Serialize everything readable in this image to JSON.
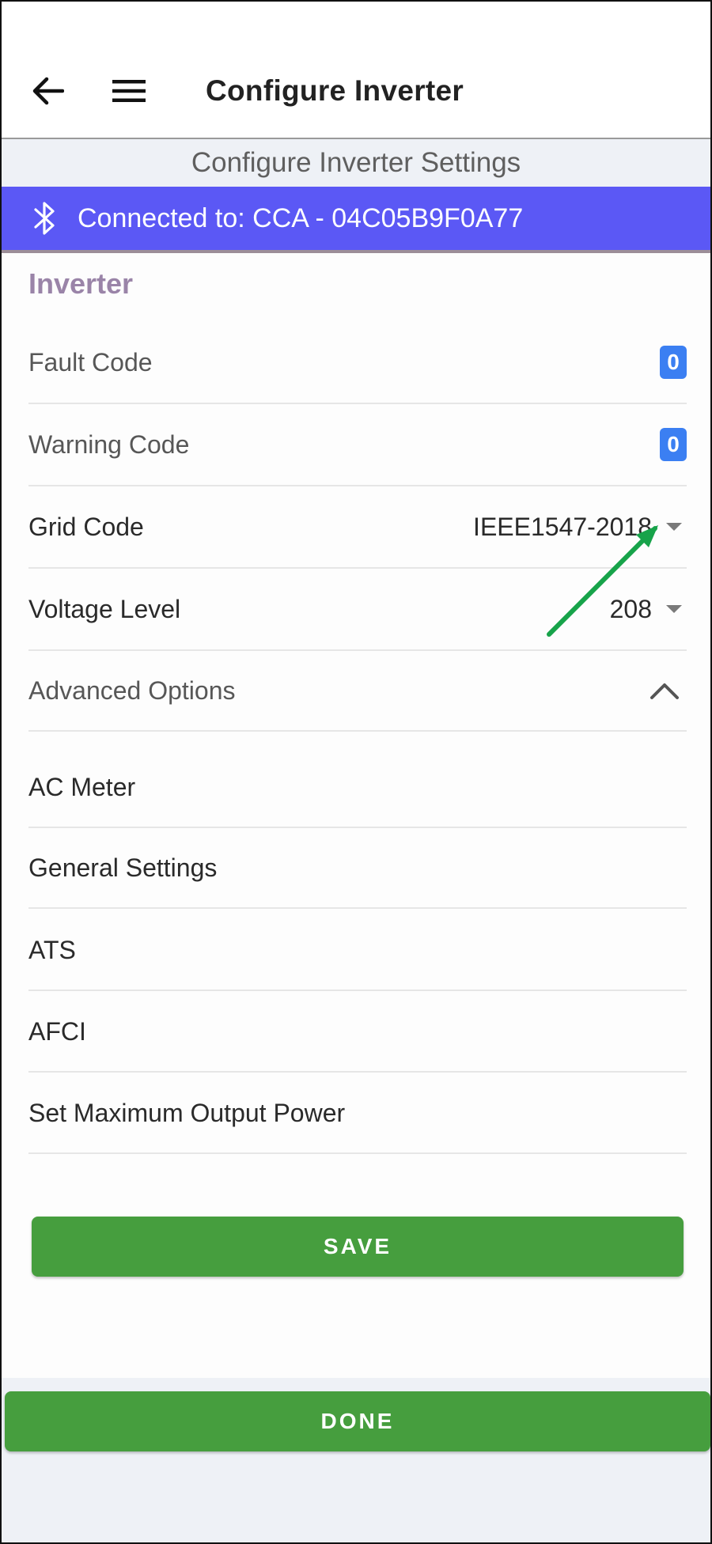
{
  "appbar": {
    "title": "Configure Inverter",
    "back_icon": "arrow-left-icon",
    "menu_icon": "hamburger-menu-icon"
  },
  "subheader": {
    "title": "Configure Inverter Settings"
  },
  "connection": {
    "icon": "bluetooth-icon",
    "text": "Connected to: CCA - 04C05B9F0A77",
    "color": "#5b58f5"
  },
  "section": {
    "title": "Inverter"
  },
  "rows": {
    "fault_code": {
      "label": "Fault Code",
      "value": "0"
    },
    "warning_code": {
      "label": "Warning Code",
      "value": "0"
    },
    "grid_code": {
      "label": "Grid Code",
      "value": "IEEE1547-2018"
    },
    "voltage_level": {
      "label": "Voltage Level",
      "value": "208"
    },
    "advanced_options": {
      "label": "Advanced Options",
      "icon": "chevron-up-icon"
    }
  },
  "advanced": {
    "items": [
      "AC Meter",
      "General Settings",
      "ATS",
      "AFCI",
      "Set Maximum Output Power"
    ]
  },
  "buttons": {
    "save": "SAVE",
    "done": "DONE",
    "color": "#469e3e"
  },
  "annotation": {
    "icon": "green-arrow-icon",
    "color": "#17a34a"
  }
}
